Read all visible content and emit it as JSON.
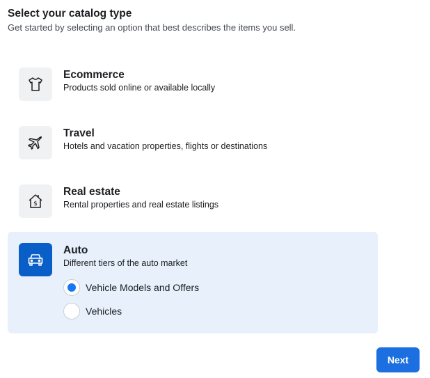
{
  "header": {
    "title": "Select your catalog type",
    "subtitle": "Get started by selecting an option that best describes the items you sell."
  },
  "options": [
    {
      "name": "Ecommerce",
      "description": "Products sold online or available locally",
      "icon": "shirt-icon",
      "selected": false
    },
    {
      "name": "Travel",
      "description": "Hotels and vacation properties, flights or destinations",
      "icon": "airplane-icon",
      "selected": false
    },
    {
      "name": "Real estate",
      "description": "Rental properties and real estate listings",
      "icon": "house-dollar-icon",
      "selected": false
    },
    {
      "name": "Auto",
      "description": "Different tiers of the auto market",
      "icon": "car-icon",
      "selected": true,
      "suboptions": [
        {
          "label": "Vehicle Models and Offers",
          "checked": true
        },
        {
          "label": "Vehicles",
          "checked": false
        }
      ]
    }
  ],
  "footer": {
    "next_label": "Next"
  },
  "colors": {
    "selected_bg": "#e7f0fb",
    "selected_tile": "#0a5ec8",
    "accent": "#1877f2",
    "button": "#1b6fe0",
    "tile_bg": "#f0f1f3"
  }
}
